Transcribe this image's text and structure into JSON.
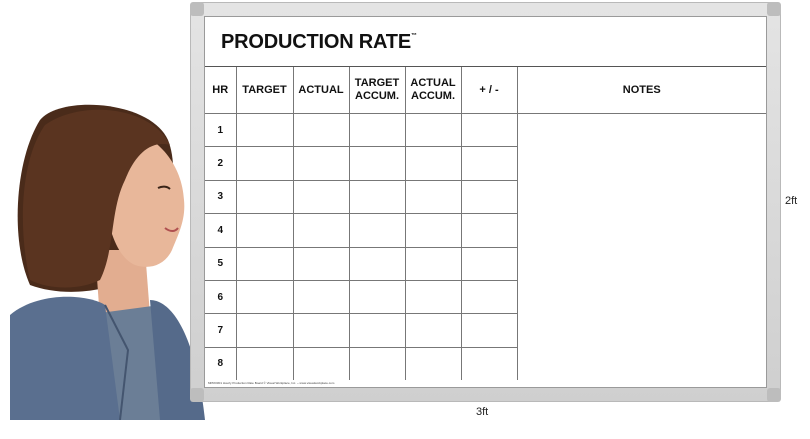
{
  "board": {
    "title": "PRODUCTION RATE",
    "trademark": "™",
    "columns": [
      "HR",
      "TARGET",
      "ACTUAL",
      "TARGET ACCUM.",
      "ACTUAL ACCUM.",
      "+ / -",
      "NOTES"
    ],
    "hours": [
      "1",
      "2",
      "3",
      "4",
      "5",
      "6",
      "7",
      "8"
    ],
    "fineprint": "MPRO#01 Hourly Production Rate Board © Visual Workplace, Inc. ~ www.visualworkplace.com"
  },
  "dimensions": {
    "width_label": "3ft",
    "height_label": "2ft"
  },
  "colors": {
    "frame": "#d6d6d6",
    "jacket": "#5a6f8f",
    "hair": "#4a2b1a",
    "skin": "#e8b79a"
  }
}
